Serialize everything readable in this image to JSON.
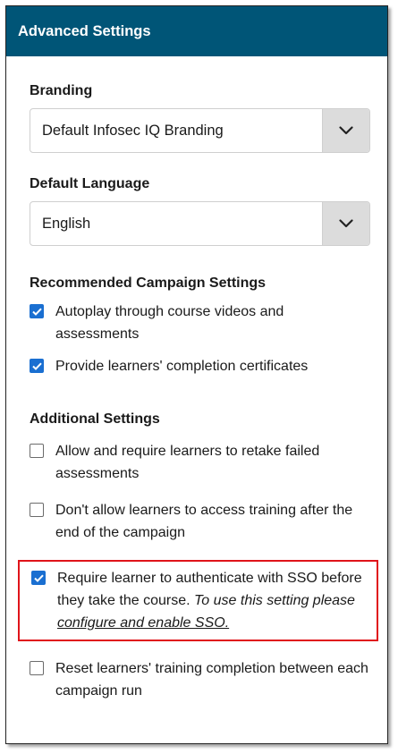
{
  "header": {
    "title": "Advanced Settings"
  },
  "branding": {
    "label": "Branding",
    "selected": "Default Infosec IQ Branding"
  },
  "language": {
    "label": "Default Language",
    "selected": "English"
  },
  "recommended": {
    "label": "Recommended Campaign Settings",
    "items": [
      {
        "text": "Autoplay through course videos and assessments",
        "checked": true
      },
      {
        "text": "Provide learners' completion certificates",
        "checked": true
      }
    ]
  },
  "additional": {
    "label": "Additional Settings",
    "items": [
      {
        "text": "Allow and require learners to retake failed assessments",
        "checked": false
      },
      {
        "text": "Don't allow learners to access training after the end of the campaign",
        "checked": false
      },
      {
        "text": "Require learner to authenticate with SSO before they take the course.",
        "checked": true,
        "note": "To use this setting please",
        "link": "configure and enable SSO."
      },
      {
        "text": "Reset learners' training completion between each campaign run",
        "checked": false
      }
    ]
  },
  "colors": {
    "header_bg": "#005577",
    "checkbox_checked": "#1a6fd1",
    "highlight_border": "#e0141a"
  },
  "icons": {
    "dropdown": "chevron-down-icon",
    "check": "checkmark-icon"
  }
}
